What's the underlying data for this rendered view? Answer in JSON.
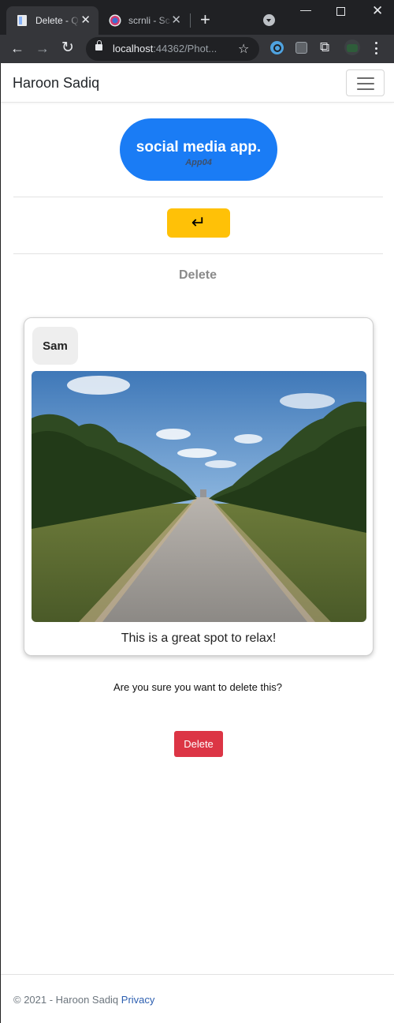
{
  "browser": {
    "tabs": [
      {
        "title": "Delete - Q",
        "active": true
      },
      {
        "title": "scrnli - Sc",
        "active": false
      }
    ],
    "url_host": "localhost",
    "url_rest": ":44362/Phot..."
  },
  "navbar": {
    "brand": "Haroon Sadiq"
  },
  "logo": {
    "title": "social media app.",
    "subtitle": "App04"
  },
  "back_button": {
    "symbol": "↵"
  },
  "page": {
    "heading": "Delete"
  },
  "post": {
    "author": "Sam",
    "caption": "This is a great spot to relax!"
  },
  "confirm": {
    "message": "Are you sure you want to delete this?",
    "delete_label": "Delete"
  },
  "footer": {
    "copyright": "© 2021 - Haroon Sadiq",
    "privacy_link": "Privacy"
  },
  "colors": {
    "brand_blue": "#1a7cf5",
    "warning_yellow": "#ffc107",
    "danger_red": "#dc3545"
  }
}
